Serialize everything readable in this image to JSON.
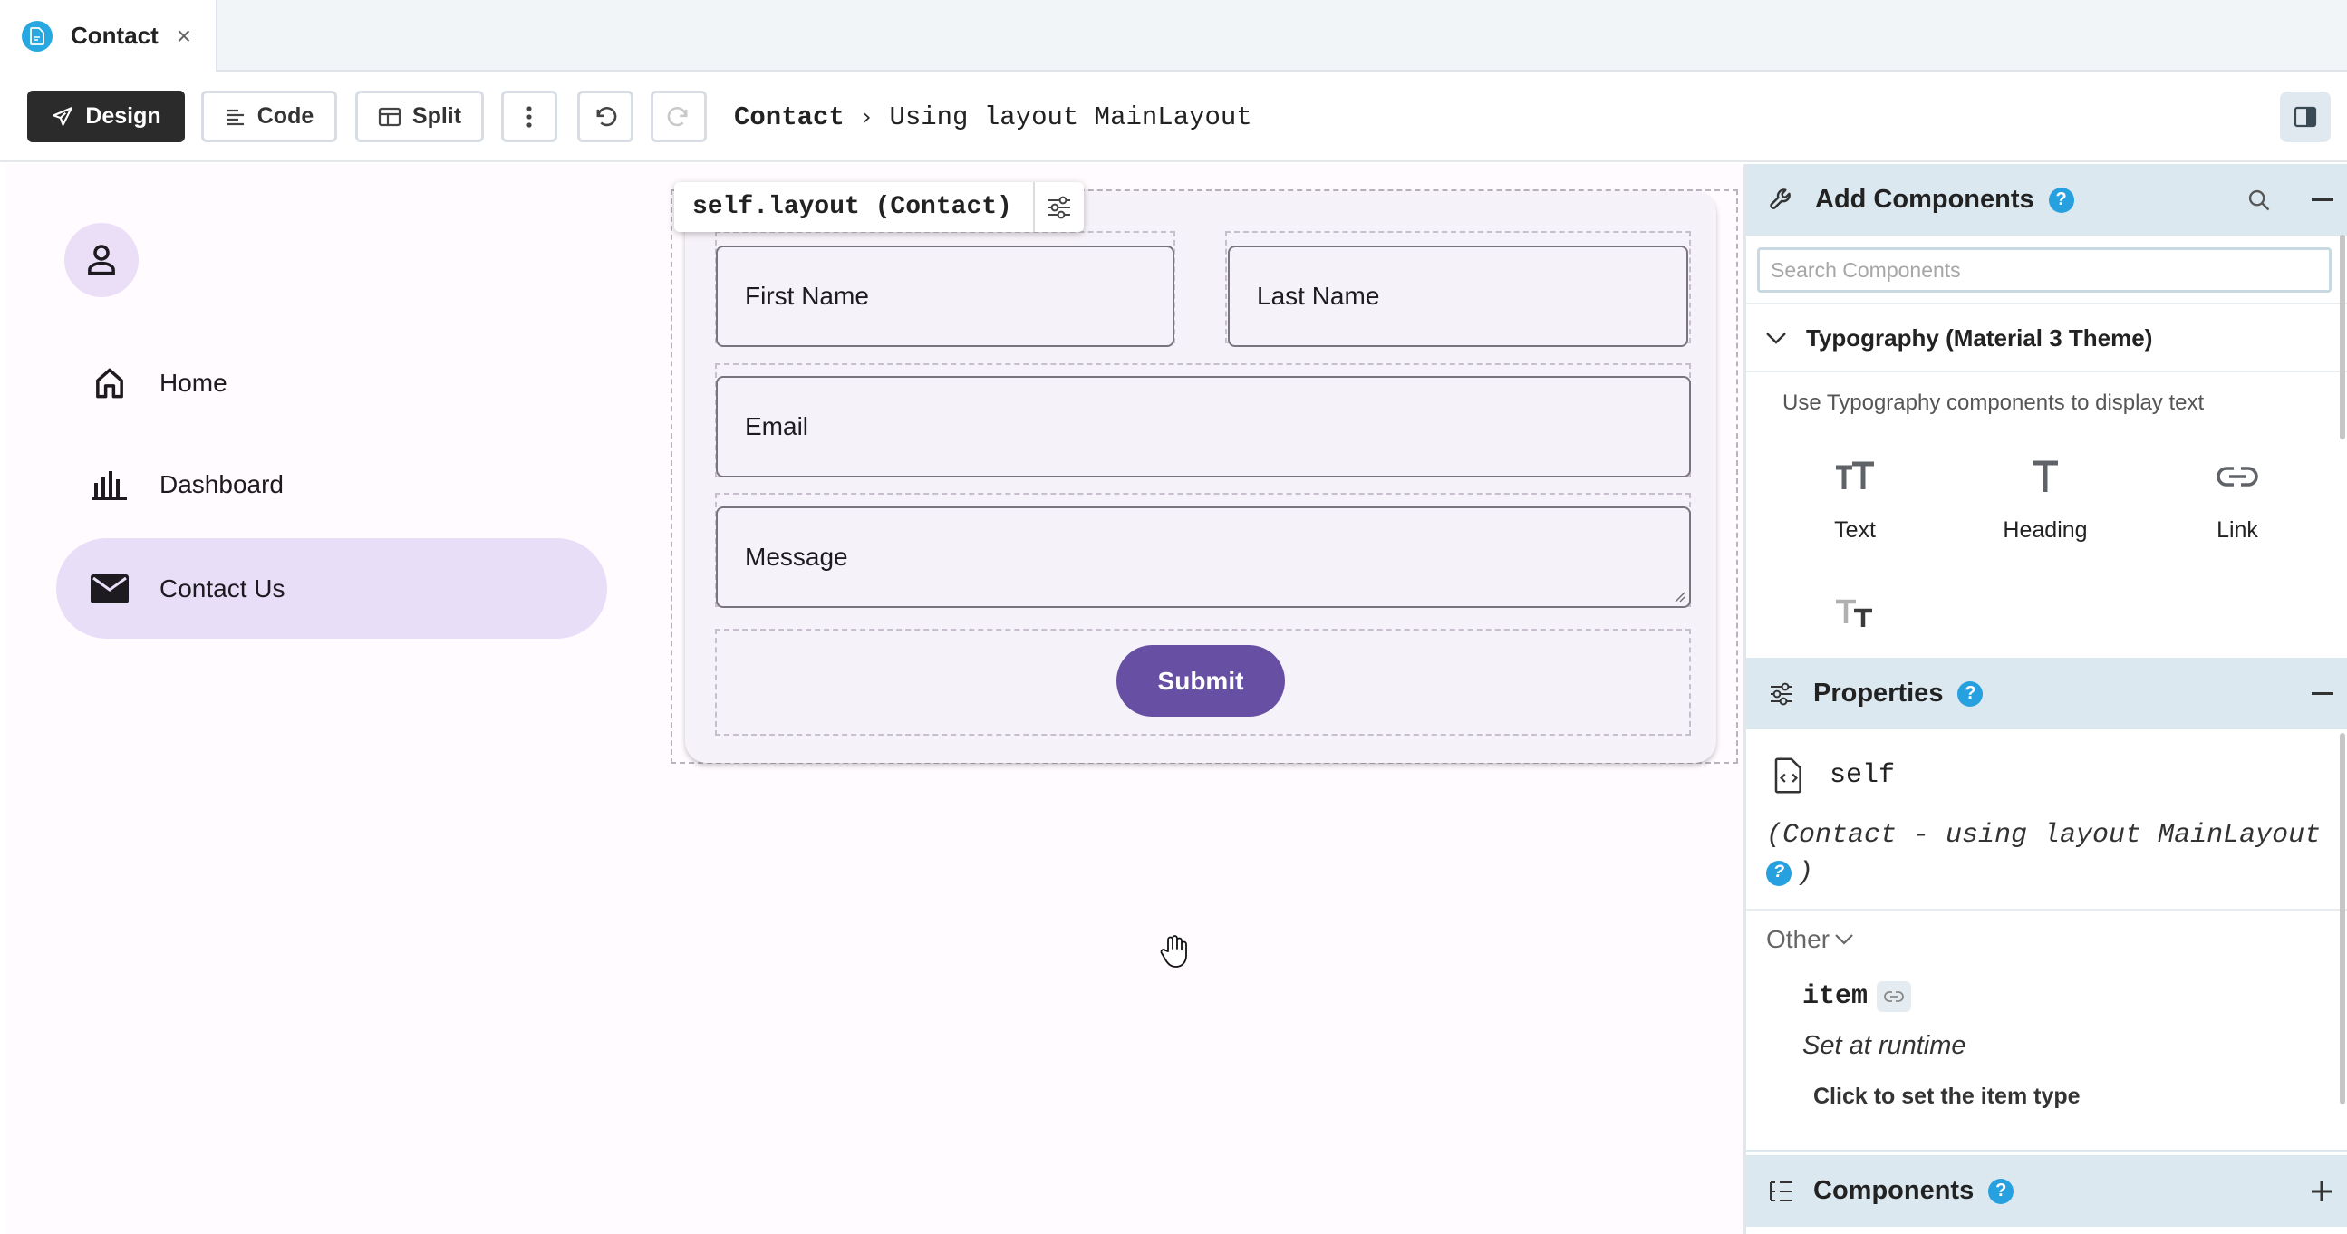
{
  "tab": {
    "label": "Contact",
    "close": "×"
  },
  "toolbar": {
    "design_label": "Design",
    "code_label": "Code",
    "split_label": "Split",
    "breadcrumb_form": "Contact",
    "breadcrumb_sep": "›",
    "breadcrumb_layout": "Using layout MainLayout"
  },
  "nav": {
    "items": [
      {
        "label": "Home",
        "icon": "home-icon"
      },
      {
        "label": "Dashboard",
        "icon": "bar-chart-icon"
      },
      {
        "label": "Contact Us",
        "icon": "mail-icon",
        "active": true
      }
    ]
  },
  "form": {
    "layout_label": "self.layout (Contact)",
    "first_name": "First Name",
    "last_name": "Last Name",
    "email": "Email",
    "message": "Message",
    "submit": "Submit"
  },
  "add_components": {
    "title": "Add Components",
    "search_placeholder": "Search Components",
    "group_title": "Typography (Material 3 Theme)",
    "group_desc": "Use Typography components to display text",
    "tiles": [
      {
        "label": "Text",
        "icon": "text-icon"
      },
      {
        "label": "Heading",
        "icon": "heading-icon"
      },
      {
        "label": "Link",
        "icon": "link-icon"
      },
      {
        "label": "",
        "icon": "rich-text-icon"
      }
    ]
  },
  "properties": {
    "title": "Properties",
    "object_name": "self",
    "object_desc_1": "(Contact - using layout MainLayout",
    "object_desc_2": ")",
    "other_label": "Other",
    "item_name": "item",
    "item_value": "Set at runtime",
    "item_action": "Click to set the item type"
  },
  "components_panel": {
    "title": "Components"
  },
  "colors": {
    "primary": "#6750a4",
    "nav_active": "#e8def8",
    "panel_header": "#dbe8ef",
    "help_badge": "#27a0e0"
  }
}
